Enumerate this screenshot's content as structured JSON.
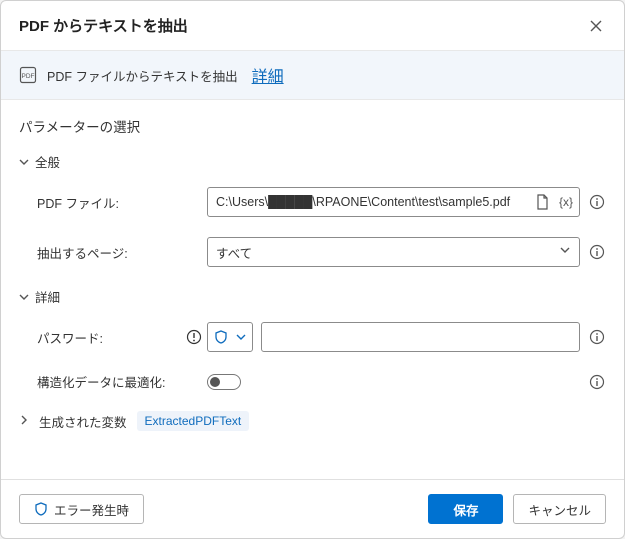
{
  "header": {
    "title": "PDF からテキストを抽出"
  },
  "banner": {
    "text": "PDF ファイルからテキストを抽出",
    "link_label": "詳細"
  },
  "section": {
    "title": "パラメーターの選択"
  },
  "groups": {
    "general": {
      "label": "全般"
    },
    "advanced": {
      "label": "詳細"
    },
    "generated": {
      "label": "生成された変数",
      "variable": "ExtractedPDFText"
    }
  },
  "fields": {
    "pdf_file": {
      "label": "PDF ファイル:",
      "value": "C:\\Users\\█████\\RPAONE\\Content\\test\\sample5.pdf"
    },
    "pages": {
      "label": "抽出するページ:",
      "selected": "すべて"
    },
    "password": {
      "label": "パスワード:",
      "value": ""
    },
    "optimize": {
      "label": "構造化データに最適化:",
      "value": false
    }
  },
  "footer": {
    "on_error": "エラー発生時",
    "save": "保存",
    "cancel": "キャンセル"
  }
}
